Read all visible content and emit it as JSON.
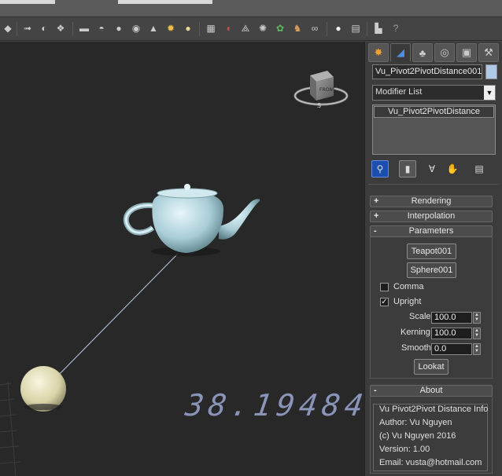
{
  "toolbar": {
    "icons": [
      "select-filter-icon",
      "named-selection-icon",
      "curve-editor-icon",
      "schematic-view-icon",
      "box-primitive-icon",
      "hemisphere-primitive-icon",
      "sphere-primitive-icon",
      "torus-primitive-icon",
      "cone-primitive-icon",
      "sun-light-icon",
      "circle-shape-icon",
      "checker-material-icon",
      "render-setup-icon",
      "render-frame-icon",
      "render-production-icon",
      "scatter-plant-icon",
      "walkthrough-icon",
      "glasses-icon",
      "teapot-render-icon",
      "calculator-icon",
      "layer-manager-icon",
      "help-icon"
    ]
  },
  "viewport": {
    "viewcube_label": "FRONT",
    "distance_readout": "38.19484"
  },
  "command_panel": {
    "tabs": [
      {
        "name": "create-tab",
        "glyph": "✸"
      },
      {
        "name": "modify-tab",
        "glyph": "◢"
      },
      {
        "name": "hierarchy-tab",
        "glyph": "♣"
      },
      {
        "name": "motion-tab",
        "glyph": "◎"
      },
      {
        "name": "display-tab",
        "glyph": "▣"
      },
      {
        "name": "utilities-tab",
        "glyph": "⚒"
      }
    ],
    "object_name": "Vu_Pivot2PivotDistance001",
    "object_color": "#b0c8e8",
    "modifier_list_label": "Modifier List",
    "modifier_stack": [
      "Vu_Pivot2PivotDistance"
    ],
    "stack_tools": [
      "pin-stack",
      "show-end-result",
      "make-unique",
      "configure-sets"
    ]
  },
  "rollouts": {
    "rendering": {
      "sign": "+",
      "title": "Rendering"
    },
    "interpolation": {
      "sign": "+",
      "title": "Interpolation"
    },
    "parameters": {
      "sign": "-",
      "title": "Parameters"
    },
    "about": {
      "sign": "-",
      "title": "About"
    }
  },
  "parameters": {
    "pick_a_label": "Teapot001",
    "pick_b_label": "Sphere001",
    "comma_label": "Comma",
    "comma_checked": false,
    "upright_label": "Upright",
    "upright_checked": true,
    "scale_label": "Scale",
    "scale_value": "100.0",
    "kerning_label": "Kerning",
    "kerning_value": "100.0",
    "smooth_label": "Smooth",
    "smooth_value": "0.0",
    "lookat_label": "Lookat"
  },
  "about": {
    "lines": [
      "Vu Pivot2Pivot Distance Info",
      "Author: Vu Nguyen",
      "(c) Vu Nguyen 2016",
      "Version: 1.00",
      "Email: vusta@hotmail.com"
    ]
  },
  "colors": {
    "viewport_bg": "#282828",
    "teapot": "#c8e4ea",
    "sphere": "#e8e6c4",
    "readout": "#8a94b8",
    "link_line": "#b8c8e8"
  }
}
